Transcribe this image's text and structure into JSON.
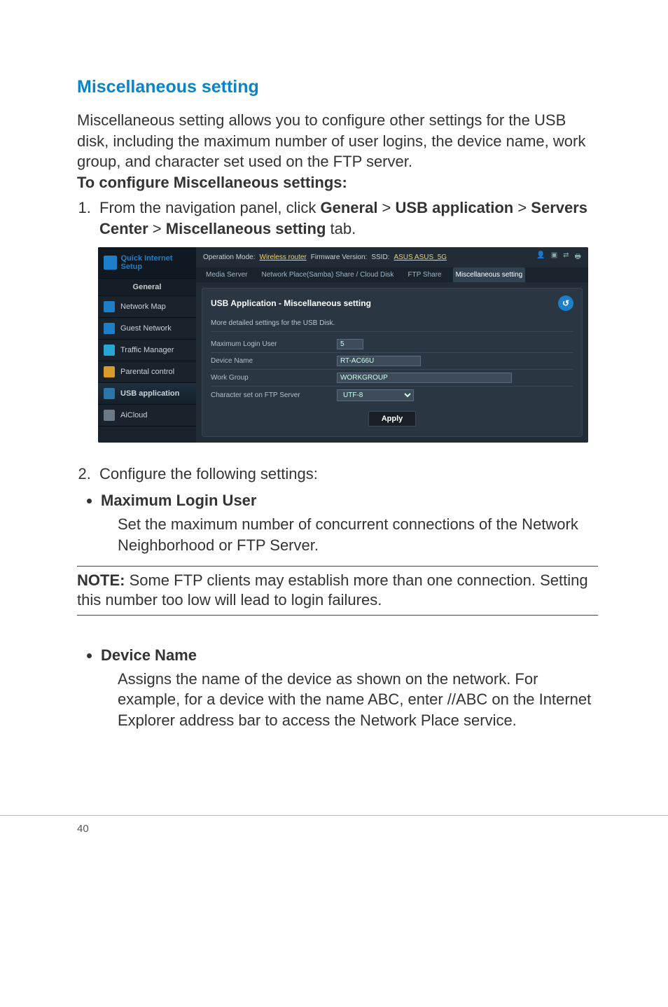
{
  "title": "Miscellaneous setting",
  "intro": "Miscellaneous setting allows you to configure other settings for the USB disk, including the maximum number of user logins, the device name, work group, and character set used on the FTP server.",
  "configure_heading": "To configure Miscellaneous settings:",
  "step1": {
    "prefix": "From the navigation panel, click ",
    "g": "General",
    "sep": " > ",
    "usb": "USB application",
    "sc": "Servers Center",
    "misc": "Miscellaneous setting",
    "tab": " tab."
  },
  "router": {
    "qis": "Quick Internet Setup",
    "general": "General",
    "side": [
      "Network Map",
      "Guest Network",
      "Traffic Manager",
      "Parental control",
      "USB application",
      "AiCloud"
    ],
    "topbar": {
      "op_label": "Operation Mode: ",
      "op_value": "Wireless router",
      "fw_label": "Firmware Version:",
      "ssid_label": "SSID: ",
      "ssid_value": "ASUS  ASUS_5G"
    },
    "tabs": [
      "Media Server",
      "Network Place(Samba) Share / Cloud Disk",
      "FTP Share",
      "Miscellaneous setting"
    ],
    "panel_title": "USB Application - Miscellaneous setting",
    "panel_sub": "More detailed settings for the USB Disk.",
    "fields": {
      "max_login": {
        "label": "Maximum Login User",
        "value": "5"
      },
      "device_name": {
        "label": "Device Name",
        "value": "RT-AC66U"
      },
      "work_group": {
        "label": "Work Group",
        "value": "WORKGROUP"
      },
      "charset": {
        "label": "Character set on FTP Server",
        "value": "UTF-8"
      }
    },
    "apply": "Apply"
  },
  "step2": "Configure the following settings:",
  "bullet1": {
    "title": "Maximum Login User",
    "desc": "Set the maximum number of concurrent connections of the Network Neighborhood or FTP Server."
  },
  "note": {
    "label": "NOTE:",
    "text": " Some FTP clients may establish more than one connection. Setting this number too low will lead to login failures."
  },
  "bullet2": {
    "title": "Device Name",
    "desc": "Assigns the name of the device as shown on the network. For example, for a device with the name ABC, enter //ABC on the Internet Explorer address bar to access the Network Place service."
  },
  "page_number": "40"
}
